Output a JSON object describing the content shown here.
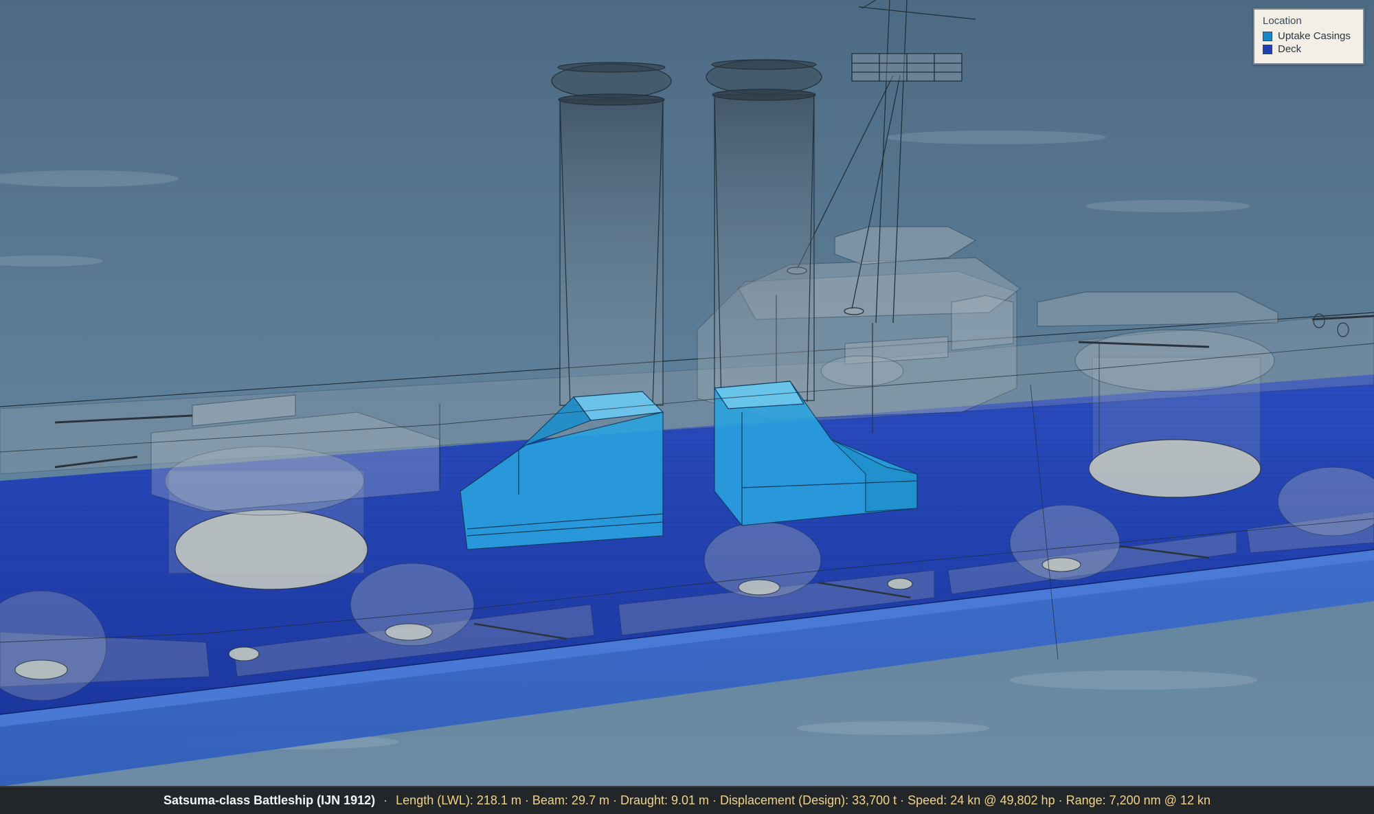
{
  "legend": {
    "title": "Location",
    "items": [
      {
        "label": "Uptake Casings",
        "color": "#1a87c9"
      },
      {
        "label": "Deck",
        "color": "#1f3fae"
      }
    ]
  },
  "status": {
    "ship_name": "Satsuma-class Battleship (IJN 1912)",
    "separator": "·",
    "specs": "Length (LWL): 218.1 m · Beam: 29.7 m · Draught: 9.01 m · Displacement (Design): 33,700 t · Speed: 24 kn @ 49,802 hp · Range: 7,200 nm @ 12 kn"
  },
  "colors": {
    "sea": "#5a7a93",
    "deck": "#1f3fae",
    "uptake": "#2aa4e0",
    "status_bar": "#232629",
    "spec_text": "#f0d38a"
  }
}
